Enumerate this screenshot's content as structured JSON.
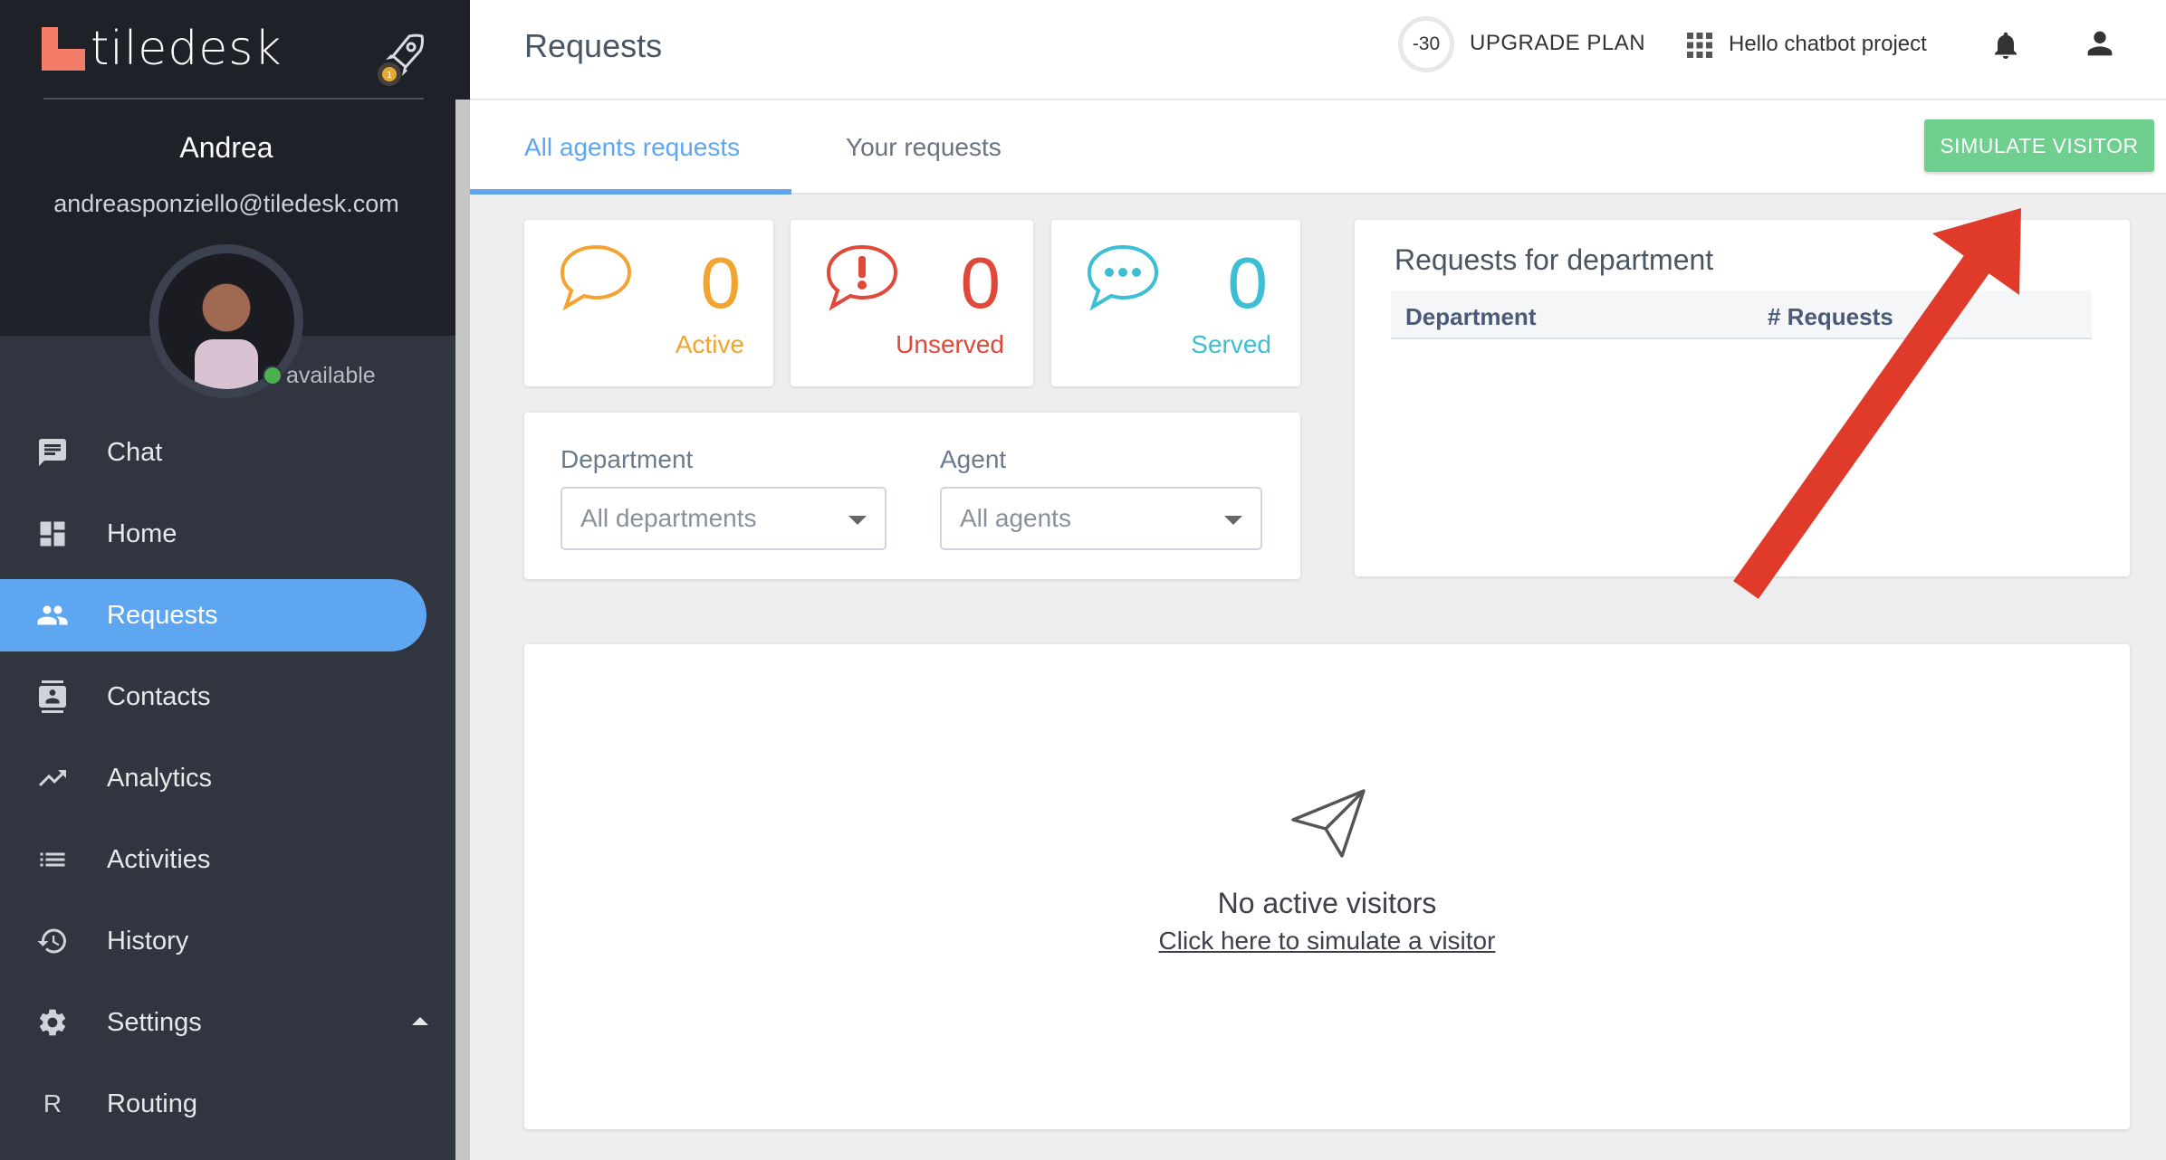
{
  "sidebar": {
    "logo_text": "tiledesk",
    "user_name": "Andrea",
    "user_email": "andreasponziello@tiledesk.com",
    "status": "available",
    "items": [
      {
        "label": "Chat",
        "icon": "chat-icon"
      },
      {
        "label": "Home",
        "icon": "dashboard-icon"
      },
      {
        "label": "Requests",
        "icon": "people-icon",
        "active": true
      },
      {
        "label": "Contacts",
        "icon": "contacts-icon"
      },
      {
        "label": "Analytics",
        "icon": "trending-up-icon"
      },
      {
        "label": "Activities",
        "icon": "list-icon"
      },
      {
        "label": "History",
        "icon": "history-icon"
      },
      {
        "label": "Settings",
        "icon": "gear-icon",
        "expanded": true
      },
      {
        "label": "Routing",
        "icon_letter": "R"
      }
    ]
  },
  "header": {
    "title": "Requests",
    "trial_days": "-30",
    "upgrade_label": "UPGRADE PLAN",
    "project_name": "Hello chatbot project"
  },
  "tabs": [
    {
      "label": "All agents requests",
      "active": true
    },
    {
      "label": "Your requests",
      "active": false
    }
  ],
  "simulate_button": "SIMULATE VISITOR",
  "stats": {
    "active": {
      "value": "0",
      "label": "Active",
      "color": "#f3a430"
    },
    "unserved": {
      "value": "0",
      "label": "Unserved",
      "color": "#e0483a"
    },
    "served": {
      "value": "0",
      "label": "Served",
      "color": "#3cbfd4"
    }
  },
  "filters": {
    "department_label": "Department",
    "department_value": "All departments",
    "agent_label": "Agent",
    "agent_value": "All agents"
  },
  "department_panel": {
    "title": "Requests for department",
    "columns": [
      "Department",
      "# Requests"
    ]
  },
  "empty_state": {
    "title": "No active visitors",
    "link": "Click here to simulate a visitor"
  },
  "colors": {
    "accent": "#5ea7f0",
    "simulate": "#6fcf8f",
    "sidebar_bg": "#303540",
    "annotation_arrow": "#e03a2a"
  }
}
